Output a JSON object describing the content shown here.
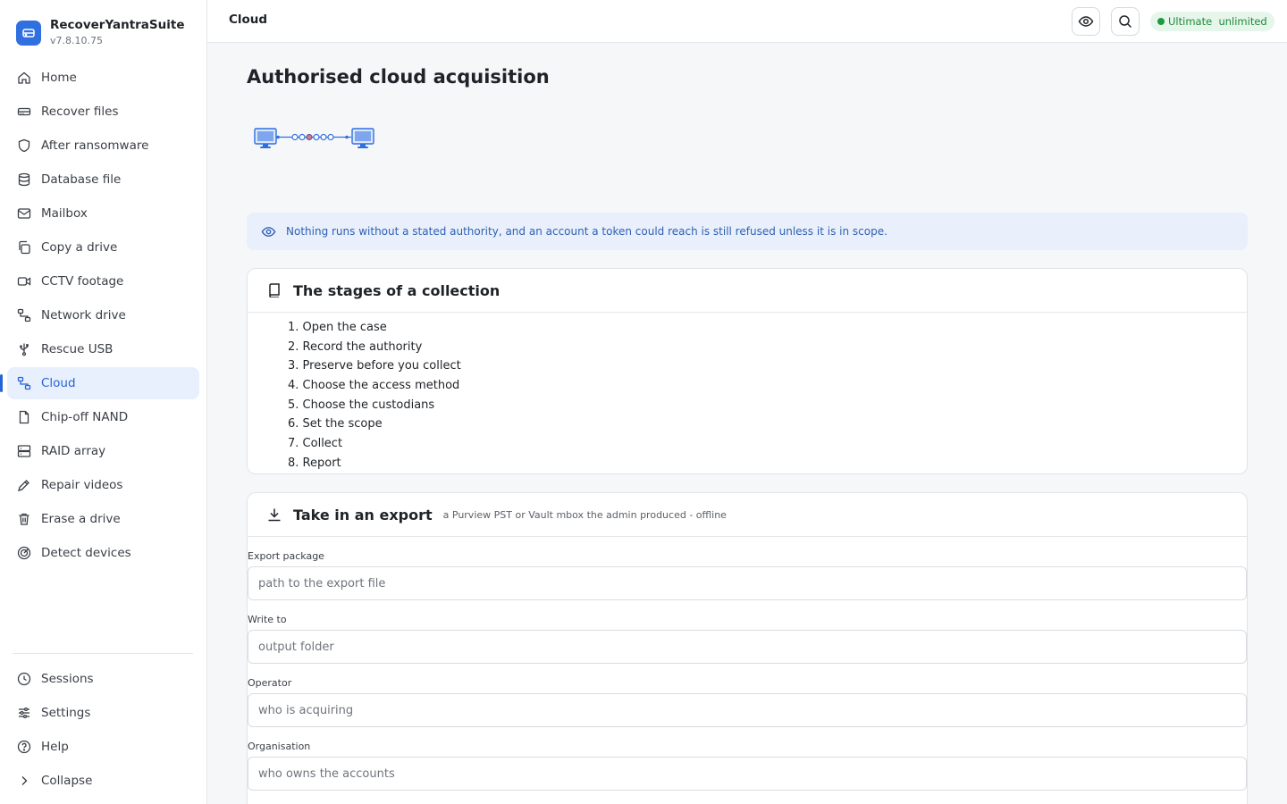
{
  "app": {
    "name": "RecoverYantraSuite",
    "version": "v7.8.10.75"
  },
  "sidebar": {
    "items": [
      {
        "label": "Home",
        "icon": "home-icon"
      },
      {
        "label": "Recover files",
        "icon": "drive-icon"
      },
      {
        "label": "After ransomware",
        "icon": "shield-icon"
      },
      {
        "label": "Database file",
        "icon": "database-icon"
      },
      {
        "label": "Mailbox",
        "icon": "mail-icon"
      },
      {
        "label": "Copy a drive",
        "icon": "copy-icon"
      },
      {
        "label": "CCTV footage",
        "icon": "camera-icon"
      },
      {
        "label": "Network drive",
        "icon": "network-icon"
      },
      {
        "label": "Rescue USB",
        "icon": "usb-icon"
      },
      {
        "label": "Cloud",
        "icon": "network-icon",
        "active": true
      },
      {
        "label": "Chip-off NAND",
        "icon": "file-icon"
      },
      {
        "label": "RAID array",
        "icon": "server-icon"
      },
      {
        "label": "Repair videos",
        "icon": "wrench-icon"
      },
      {
        "label": "Erase a drive",
        "icon": "trash-icon"
      },
      {
        "label": "Detect devices",
        "icon": "radar-icon"
      }
    ],
    "bottom": [
      {
        "label": "Sessions",
        "icon": "clock-icon"
      },
      {
        "label": "Settings",
        "icon": "sliders-icon"
      },
      {
        "label": "Help",
        "icon": "help-icon"
      },
      {
        "label": "Collapse",
        "icon": "chevron-right-icon"
      }
    ]
  },
  "header": {
    "title": "Cloud",
    "license_badge": "Ultimate  unlimited"
  },
  "main": {
    "title": "Authorised cloud acquisition",
    "notice": "Nothing runs without a stated authority, and an account a token could reach is still refused unless it is in scope.",
    "stages": {
      "title": "The stages of a collection",
      "items": [
        "Open the case",
        "Record the authority",
        "Preserve before you collect",
        "Choose the access method",
        "Choose the custodians",
        "Set the scope",
        "Collect",
        "Report"
      ]
    },
    "export": {
      "title": "Take in an export",
      "subtitle": "a Purview PST or Vault mbox the admin produced - offline",
      "fields": [
        {
          "label": "Export package",
          "placeholder": "path to the export file"
        },
        {
          "label": "Write to",
          "placeholder": "output folder"
        },
        {
          "label": "Operator",
          "placeholder": "who is acquiring"
        },
        {
          "label": "Organisation",
          "placeholder": "who owns the accounts"
        }
      ]
    }
  },
  "colors": {
    "accent": "#2563d9",
    "badge_green": "#1e8a3a",
    "notice_bg": "#e9f0fb"
  }
}
